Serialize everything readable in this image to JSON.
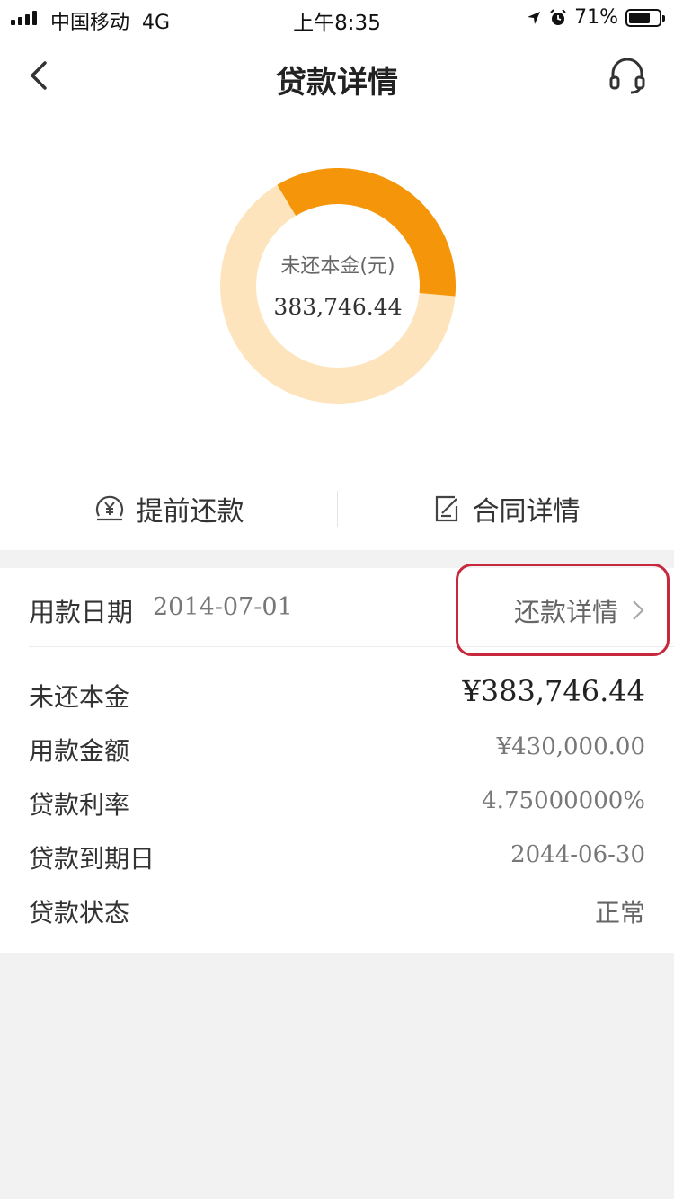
{
  "status_bar": {
    "carrier": "中国移动",
    "network": "4G",
    "time": "上午8:35",
    "battery": "71%",
    "battery_level": 0.71
  },
  "nav": {
    "title": "贷款详情"
  },
  "donut": {
    "label": "未还本金(元)",
    "value": "383,746.44",
    "remaining_fraction": 0.35,
    "colors": {
      "remaining": "#f5950a",
      "repaid": "#fde4bc"
    }
  },
  "actions": {
    "prepay_label": "提前还款",
    "contract_label": "合同详情"
  },
  "detail": {
    "date_label": "用款日期",
    "date_value": "2014-07-01",
    "repay_detail_label": "还款详情",
    "rows": [
      {
        "label": "未还本金",
        "value": "¥383,746.44"
      },
      {
        "label": "用款金额",
        "value": "¥430,000.00"
      },
      {
        "label": "贷款利率",
        "value": "4.75000000%"
      },
      {
        "label": "贷款到期日",
        "value": "2044-06-30"
      },
      {
        "label": "贷款状态",
        "value": "正常"
      }
    ]
  },
  "colors": {
    "accent": "#f5950a",
    "highlight": "#c8283c"
  }
}
